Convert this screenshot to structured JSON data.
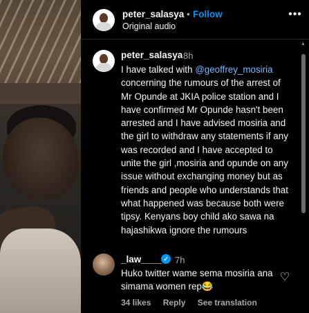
{
  "header": {
    "username": "peter_salasya",
    "separator": "•",
    "follow_label": "Follow",
    "audio_label": "Original audio",
    "more_icon": "more-horizontal-icon",
    "more_glyph": "•••"
  },
  "caption": {
    "username": "peter_salasya",
    "time": "8h",
    "text_before_mention": "I have talked with ",
    "mention": "@geoffrey_mosiria",
    "text_after_mention": " concerning the rumours of the arrest of Mr Opunde at JKIA  police station and I have confirmed Mr Opunde hasn't been arrested and I have advised mosiria and the girl to withdraw  any statements if any was recorded and I have accepted to unite the girl ,mosiria and opunde on any issue without exchanging money but as friends and people who understands that what happened was because both were tipsy. Kenyans boy child ako sawa na hajashikwa ignore the rumours"
  },
  "comment": {
    "username": "_law____",
    "verified_glyph": "✓",
    "time": "7h",
    "text": "Huko twitter wame sema mosiria ana simama women rep😂",
    "heart_glyph": "♡",
    "likes": "34 likes",
    "reply_label": "Reply",
    "translation_label": "See translation"
  },
  "scrollbar": {
    "up_glyph": "▲"
  }
}
